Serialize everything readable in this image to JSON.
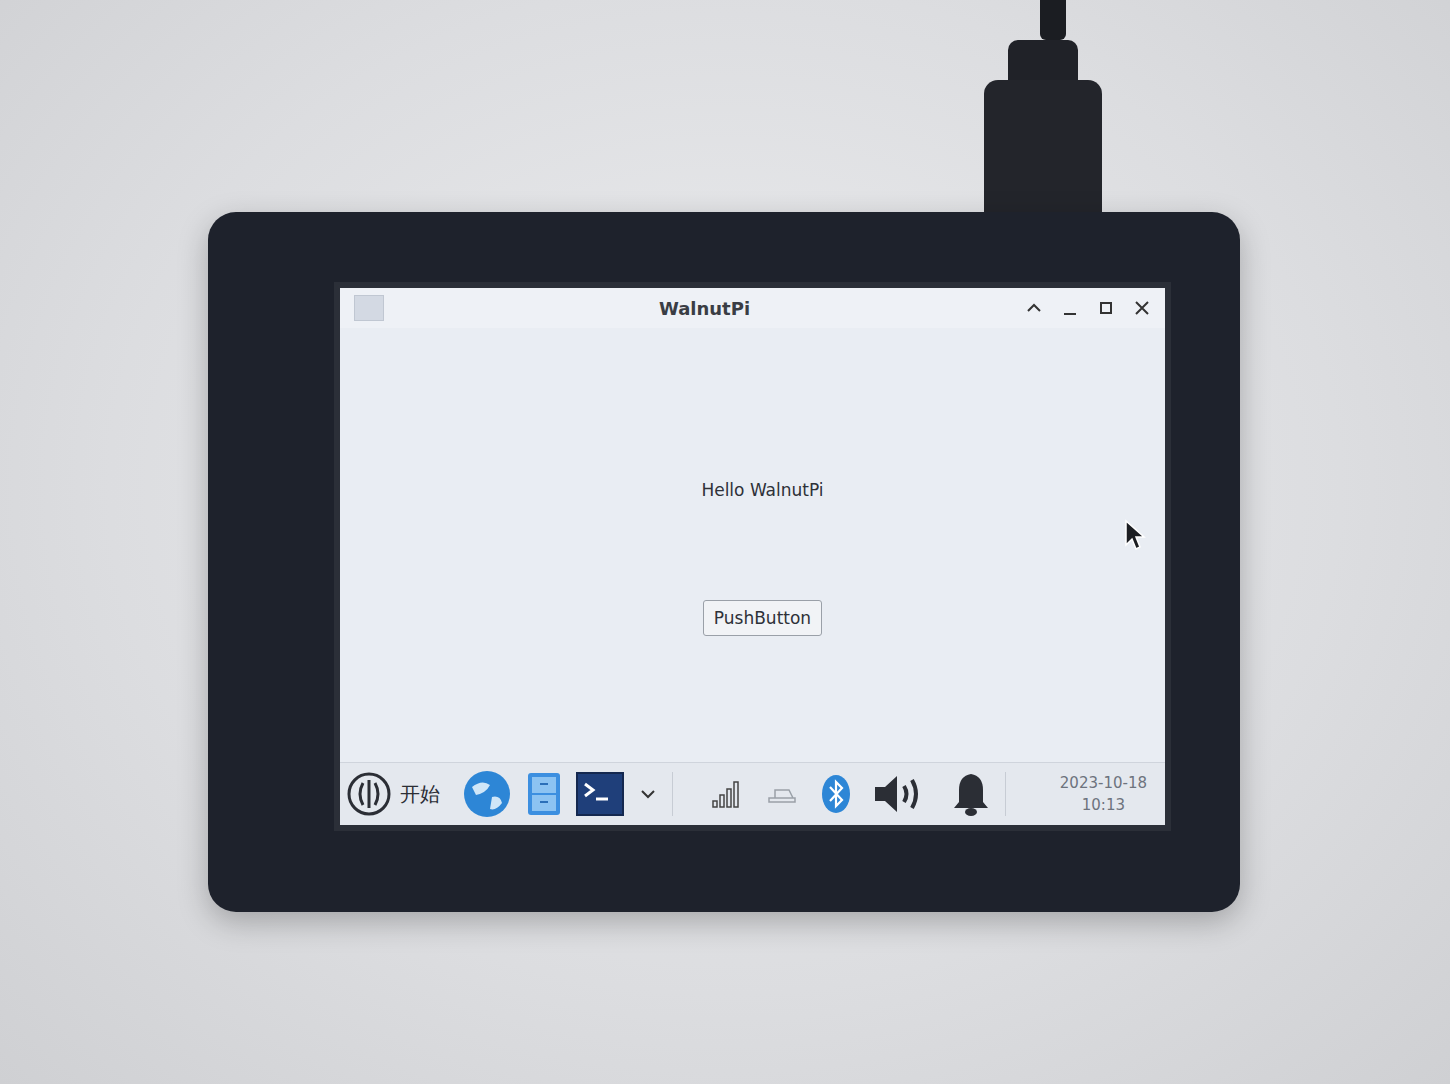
{
  "window": {
    "title": "WalnutPi"
  },
  "content": {
    "label": "Hello WalnutPi",
    "button": "PushButton"
  },
  "taskbar": {
    "start": "开始",
    "date": "2023-10-18",
    "time": "10:13"
  }
}
